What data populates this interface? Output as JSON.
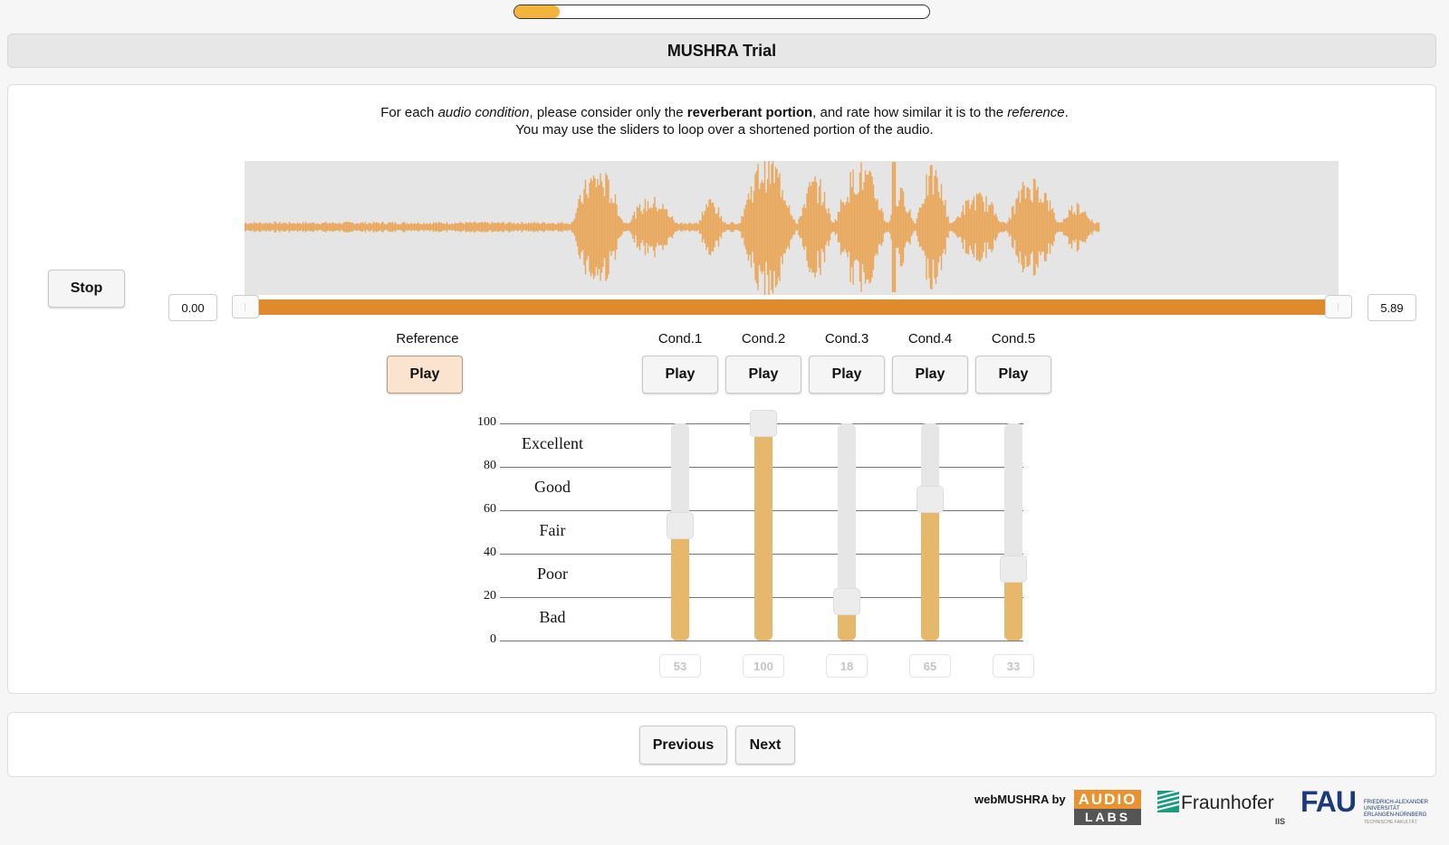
{
  "progress": {
    "fraction": 0.11
  },
  "header": {
    "title": "MUSHRA Trial"
  },
  "instructions": {
    "line1": [
      {
        "text": "For each ",
        "style": "normal"
      },
      {
        "text": "audio condition",
        "style": "italic"
      },
      {
        "text": ", please consider only the ",
        "style": "normal"
      },
      {
        "text": "reverberant portion",
        "style": "bold"
      },
      {
        "text": ", and rate how similar it is to the ",
        "style": "normal"
      },
      {
        "text": "reference",
        "style": "italic"
      },
      {
        "text": ".",
        "style": "normal"
      }
    ],
    "line2": "You may use the sliders to loop over a shortened portion of the audio."
  },
  "player": {
    "stop_label": "Stop",
    "range_start": "0.00",
    "range_end": "5.89",
    "waveform_color": "#e8a85c",
    "bar_color": "#e08a2c"
  },
  "reference": {
    "label": "Reference",
    "play_label": "Play"
  },
  "conditions": [
    {
      "label": "Cond.1",
      "play_label": "Play",
      "rating": 53
    },
    {
      "label": "Cond.2",
      "play_label": "Play",
      "rating": 100
    },
    {
      "label": "Cond.3",
      "play_label": "Play",
      "rating": 18
    },
    {
      "label": "Cond.4",
      "play_label": "Play",
      "rating": 65
    },
    {
      "label": "Cond.5",
      "play_label": "Play",
      "rating": 33
    }
  ],
  "scale": {
    "ticks": [
      "100",
      "80",
      "60",
      "40",
      "20",
      "0"
    ],
    "categories": [
      "Excellent",
      "Good",
      "Fair",
      "Poor",
      "Bad"
    ]
  },
  "navigation": {
    "previous_label": "Previous",
    "next_label": "Next"
  },
  "footer": {
    "by_text": "webMUSHRA by",
    "audiolabs_top": "AUDIO",
    "audiolabs_bottom": "LABS",
    "fraunhofer_name": "Fraunhofer",
    "fraunhofer_sub": "IIS",
    "fau_name": "FAU",
    "fau_line1": "FRIEDRICH-ALEXANDER",
    "fau_line2": "UNIVERSITÄT",
    "fau_line3": "ERLANGEN-NÜRNBERG",
    "fau_faculty": "TECHNISCHE FAKULTÄT"
  }
}
